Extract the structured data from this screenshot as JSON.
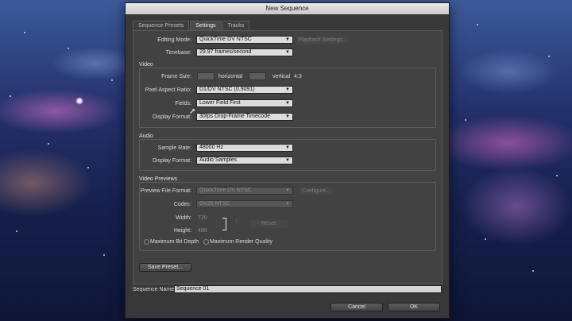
{
  "window": {
    "title": "New Sequence"
  },
  "tabs": [
    "Sequence Presets",
    "Settings",
    "Tracks"
  ],
  "general": {
    "editing_mode_label": "Editing Mode:",
    "editing_mode_value": "QuickTime DV NTSC",
    "playback_settings_label": "Playback Settings...",
    "timebase_label": "Timebase:",
    "timebase_value": "29.97 frames/second"
  },
  "video": {
    "title": "Video",
    "frame_size_label": "Frame Size:",
    "horizontal_label": "horizontal",
    "vertical_label": "vertical",
    "aspect": "4:3",
    "pixel_aspect_label": "Pixel Aspect Ratio:",
    "pixel_aspect_value": "D1/DV NTSC (0.9091)",
    "fields_label": "Fields:",
    "fields_value": "Lower Field First",
    "display_format_label": "Display Format:",
    "display_format_value": "30fps Drop-Frame Timecode"
  },
  "audio": {
    "title": "Audio",
    "sample_rate_label": "Sample Rate:",
    "sample_rate_value": "48000 Hz",
    "display_format_label": "Display Format:",
    "display_format_value": "Audio Samples"
  },
  "previews": {
    "title": "Video Previews",
    "file_format_label": "Preview File Format:",
    "file_format_value": "QuickTime DV NTSC",
    "configure_label": "Configure...",
    "codec_label": "Codec:",
    "codec_value": "DV25 NTSC",
    "width_label": "Width:",
    "width_value": "720",
    "height_label": "Height:",
    "height_value": "480",
    "reset_label": "Reset",
    "max_bit_depth_label": "Maximum Bit Depth",
    "max_render_quality_label": "Maximum Render Quality"
  },
  "save_preset_label": "Save Preset...",
  "sequence_name_label": "Sequence Name:",
  "sequence_name_value": "Sequence 01",
  "cancel_label": "Cancel",
  "ok_label": "OK"
}
